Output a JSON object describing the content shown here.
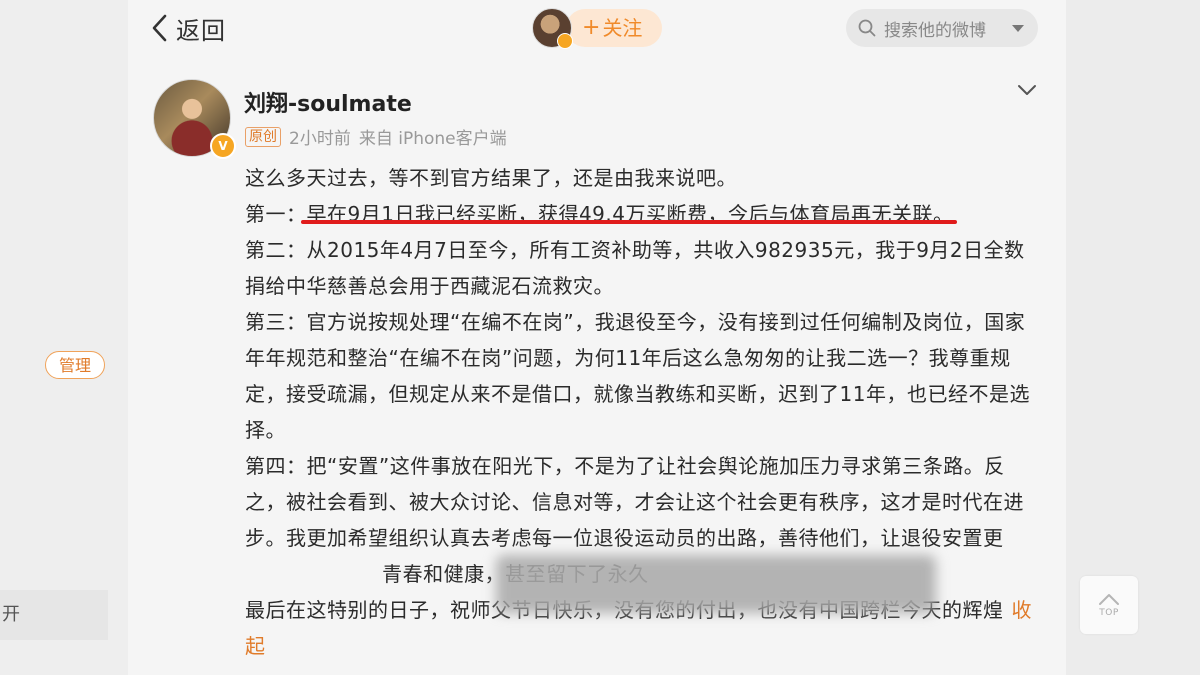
{
  "sidebar": {
    "manage_label": "管理",
    "bottom_item_label": "开"
  },
  "header": {
    "back_label": "返回",
    "follow_label": "关注",
    "follow_plus": "+",
    "search_placeholder": "搜索他的微博"
  },
  "post": {
    "username": "刘翔-soulmate",
    "original_tag": "原创",
    "time": "2小时前",
    "source": "来自 iPhone客户端",
    "paragraphs": {
      "p0": "这么多天过去，等不到官方结果了，还是由我来说吧。",
      "p1_prefix": "第一：",
      "p1_highlight": "早在9月1日我已经买断，获得49.4万买断费，今后与体育局再无关联。",
      "p2": "第二：从2015年4月7日至今，所有工资补助等，共收入982935元，我于9月2日全数捐给中华慈善总会用于西藏泥石流救灾。",
      "p3": "第三：官方说按规处理“在编不在岗”，我退役至今，没有接到过任何编制及岗位，国家年年规范和整治“在编不在岗”问题，为何11年后这么急匆匆的让我二选一？我尊重规定，接受疏漏，但规定从来不是借口，就像当教练和买断，迟到了11年，也已经不是选择。",
      "p4": "第四：把“安置”这件事放在阳光下，不是为了让社会舆论施加压力寻求第三条路。反之，被社会看到、被大众讨论、信息对等，才会让这个社会更有秩序，这才是时代在进步。我更加希望组织认真去考虑每一位退役运动员的出路，善待他们，让退役安置更",
      "p4_gap": "                    ",
      "p4_tail": "青春和健康，甚至留下了永久",
      "p5": "最后在这特别的日子，祝师父节日快乐，没有您的付出，也没有中国跨栏今天的辉煌",
      "collapse_label": "收起"
    }
  },
  "scroll_top_label": "TOP"
}
